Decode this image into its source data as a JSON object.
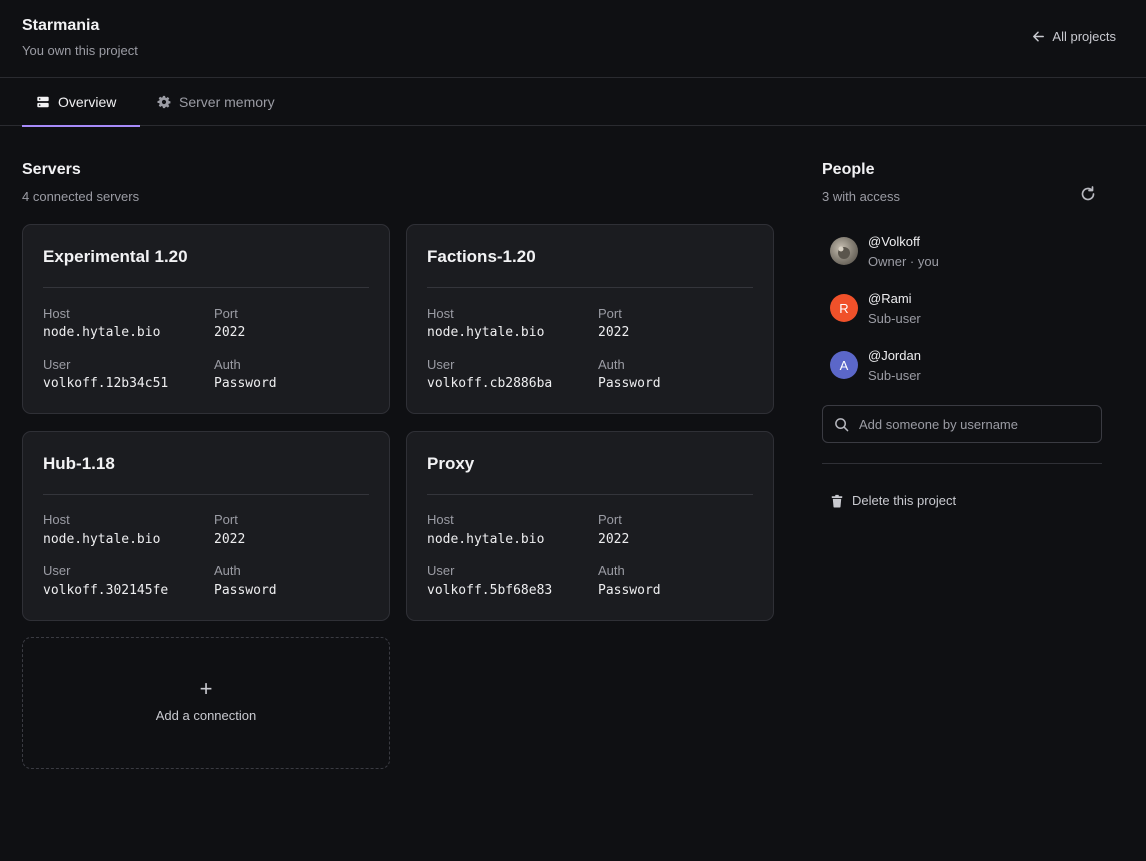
{
  "header": {
    "title": "Starmania",
    "subtitle": "You own this project",
    "back_label": "All projects"
  },
  "tabs": [
    {
      "label": "Overview",
      "icon": "server-icon",
      "active": true
    },
    {
      "label": "Server memory",
      "icon": "gear-icon",
      "active": false
    }
  ],
  "servers": {
    "title": "Servers",
    "subtitle": "4 connected servers",
    "field_labels": {
      "host": "Host",
      "port": "Port",
      "user": "User",
      "auth": "Auth"
    },
    "items": [
      {
        "name": "Experimental 1.20",
        "host": "node.hytale.bio",
        "port": "2022",
        "user": "volkoff.12b34c51",
        "auth": "Password"
      },
      {
        "name": "Factions-1.20",
        "host": "node.hytale.bio",
        "port": "2022",
        "user": "volkoff.cb2886ba",
        "auth": "Password"
      },
      {
        "name": "Hub-1.18",
        "host": "node.hytale.bio",
        "port": "2022",
        "user": "volkoff.302145fe",
        "auth": "Password"
      },
      {
        "name": "Proxy",
        "host": "node.hytale.bio",
        "port": "2022",
        "user": "volkoff.5bf68e83",
        "auth": "Password"
      }
    ],
    "add_plus": "+",
    "add_label": "Add a connection"
  },
  "people": {
    "title": "People",
    "subtitle": "3 with access",
    "members": [
      {
        "name": "@Volkoff",
        "role": "Owner · you",
        "initial": "",
        "color": "#8a8479"
      },
      {
        "name": "@Rami",
        "role": "Sub-user",
        "initial": "R",
        "color": "#f0512a"
      },
      {
        "name": "@Jordan",
        "role": "Sub-user",
        "initial": "A",
        "color": "#5b67c9"
      }
    ],
    "search_placeholder": "Add someone by username",
    "delete_label": "Delete this project"
  },
  "colors": {
    "background": "#0f1013",
    "card": "#1b1c20",
    "accent": "#a78bfa"
  }
}
